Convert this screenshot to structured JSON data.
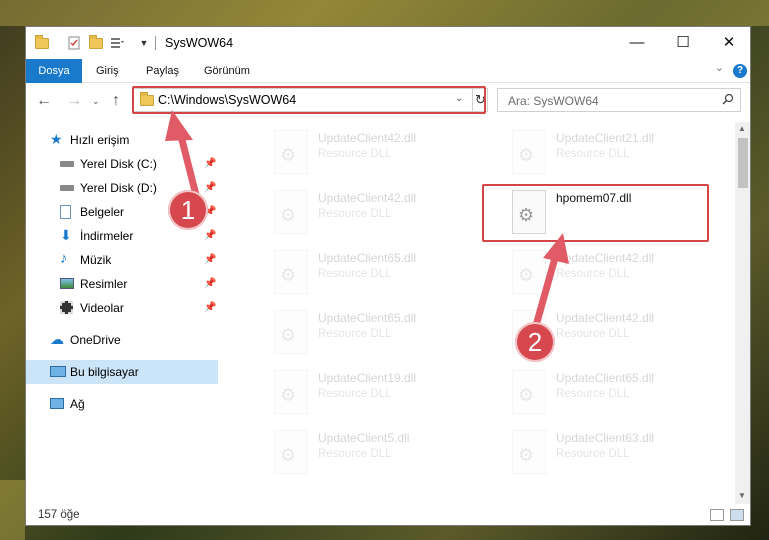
{
  "window": {
    "title": "SysWOW64",
    "controls": {
      "minimize": "—",
      "maximize": "☐",
      "close": "✕"
    }
  },
  "ribbon": {
    "tabs": [
      {
        "label": "Dosya",
        "active": true
      },
      {
        "label": "Giriş"
      },
      {
        "label": "Paylaş"
      },
      {
        "label": "Görünüm"
      }
    ],
    "help": "?"
  },
  "address": {
    "path": "C:\\Windows\\SysWOW64"
  },
  "search": {
    "placeholder": "Ara: SysWOW64"
  },
  "sidebar": {
    "quick_access": "Hızlı erişim",
    "items": [
      {
        "label": "Yerel Disk (C:)",
        "icon": "drive-icon"
      },
      {
        "label": "Yerel Disk (D:)",
        "icon": "drive-icon"
      },
      {
        "label": "Belgeler",
        "icon": "documents-icon"
      },
      {
        "label": "İndirmeler",
        "icon": "downloads-icon"
      },
      {
        "label": "Müzik",
        "icon": "music-icon"
      },
      {
        "label": "Resimler",
        "icon": "pictures-icon"
      },
      {
        "label": "Videolar",
        "icon": "videos-icon"
      }
    ],
    "onedrive": "OneDrive",
    "this_pc": "Bu bilgisayar",
    "network": "Ağ"
  },
  "files": [
    {
      "name": "UpdateClient42.dll",
      "type": "Resource DLL"
    },
    {
      "name": "UpdateClient21.dll",
      "type": "Resource DLL"
    },
    {
      "name": "UpdateClient42.dll",
      "type": "Resource DLL"
    },
    {
      "name": "hpomem07.dll",
      "type": "",
      "highlighted": true
    },
    {
      "name": "UpdateClient65.dll",
      "type": "Resource DLL"
    },
    {
      "name": "UpdateClient42.dll",
      "type": "Resource DLL"
    },
    {
      "name": "UpdateClient65.dll",
      "type": "Resource DLL"
    },
    {
      "name": "UpdateClient42.dll",
      "type": "Resource DLL"
    },
    {
      "name": "UpdateClient19.dll",
      "type": "Resource DLL"
    },
    {
      "name": "UpdateClient65.dll",
      "type": "Resource DLL"
    },
    {
      "name": "UpdateClient5.dll",
      "type": "Resource DLL"
    },
    {
      "name": "UpdateClient63.dll",
      "type": "Resource DLL"
    }
  ],
  "status": {
    "count": "157 öğe"
  },
  "annotations": {
    "step1": "1",
    "step2": "2",
    "color": "#d64545"
  }
}
